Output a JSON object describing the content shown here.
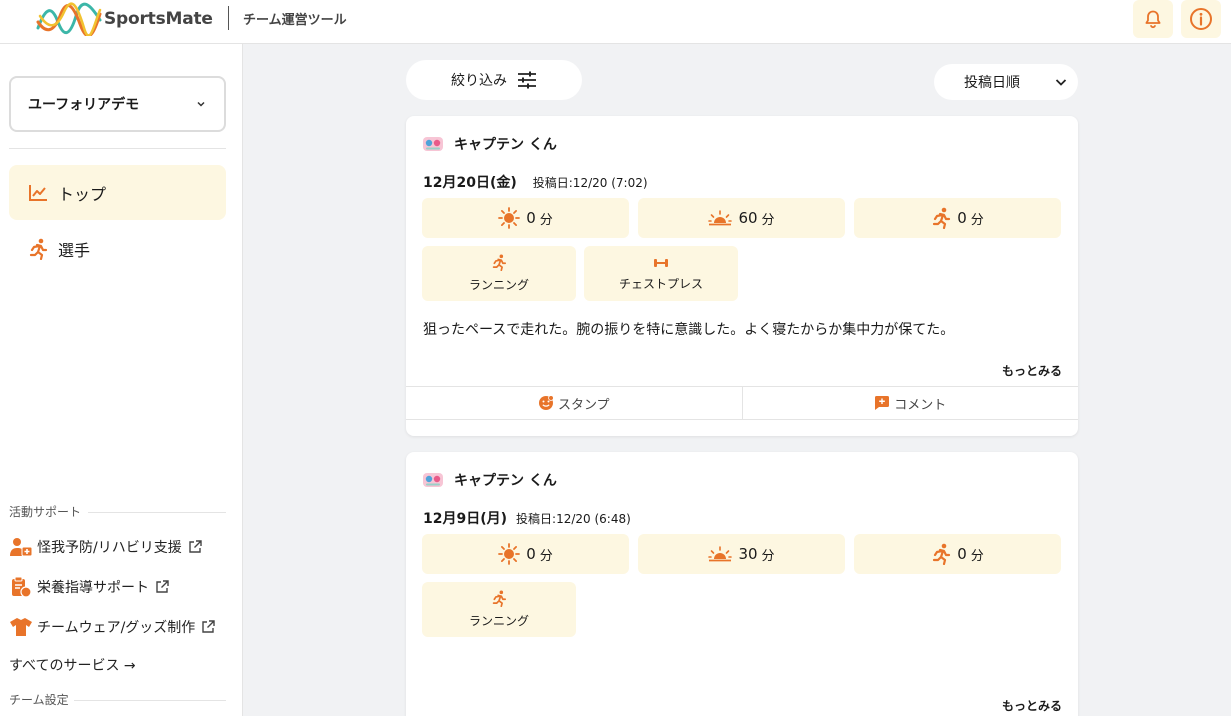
{
  "header": {
    "logo_text": "SportsMate",
    "subtitle": "チーム運営ツール",
    "icons": [
      "bell-icon",
      "info-icon"
    ]
  },
  "sidebar": {
    "team_select": "ユーフォリアデモ",
    "nav": [
      {
        "label": "トップ",
        "icon": "chart-line-icon",
        "active": true
      },
      {
        "label": "選手",
        "icon": "runner-icon",
        "active": false
      }
    ],
    "activity_support": {
      "title": "活動サポート",
      "links": [
        {
          "label": "怪我予防/リハビリ支援",
          "icon": "injury-support-icon"
        },
        {
          "label": "栄養指導サポート",
          "icon": "nutrition-clipboard-icon"
        },
        {
          "label": "チームウェア/グッズ制作",
          "icon": "tshirt-icon"
        }
      ],
      "all_services": "すべてのサービス →"
    },
    "team_settings_title": "チーム設定"
  },
  "toolbar": {
    "filter_label": "絞り込み",
    "sort_label": "投稿日順"
  },
  "posts": [
    {
      "author": "キャプテン くん",
      "date": "12月20日(金)",
      "posted": "投稿日:12/20 (7:02)",
      "stats": [
        {
          "icon": "sun-icon",
          "value": "0",
          "unit": "分"
        },
        {
          "icon": "sunrise-icon",
          "value": "60",
          "unit": "分"
        },
        {
          "icon": "running-icon",
          "value": "0",
          "unit": "分"
        }
      ],
      "activities": [
        {
          "icon": "running-icon",
          "label": "ランニング"
        },
        {
          "icon": "dumbbell-icon",
          "label": "チェストプレス"
        }
      ],
      "comment": "狙ったペースで走れた。腕の振りを特に意識した。よく寝たからか集中力が保てた。",
      "more": "もっとみる",
      "actions": {
        "stamp": "スタンプ",
        "comment": "コメント"
      }
    },
    {
      "author": "キャプテン くん",
      "date": "12月9日(月)",
      "posted": "投稿日:12/20 (6:48)",
      "stats": [
        {
          "icon": "sun-icon",
          "value": "0",
          "unit": "分"
        },
        {
          "icon": "sunrise-icon",
          "value": "30",
          "unit": "分"
        },
        {
          "icon": "running-icon",
          "value": "0",
          "unit": "分"
        }
      ],
      "activities": [
        {
          "icon": "running-icon",
          "label": "ランニング"
        }
      ],
      "more": "もっとみる"
    }
  ],
  "colors": {
    "accent": "#e8742a",
    "highlight_bg": "#fdf7e1",
    "page_bg": "#f1f2f4"
  }
}
